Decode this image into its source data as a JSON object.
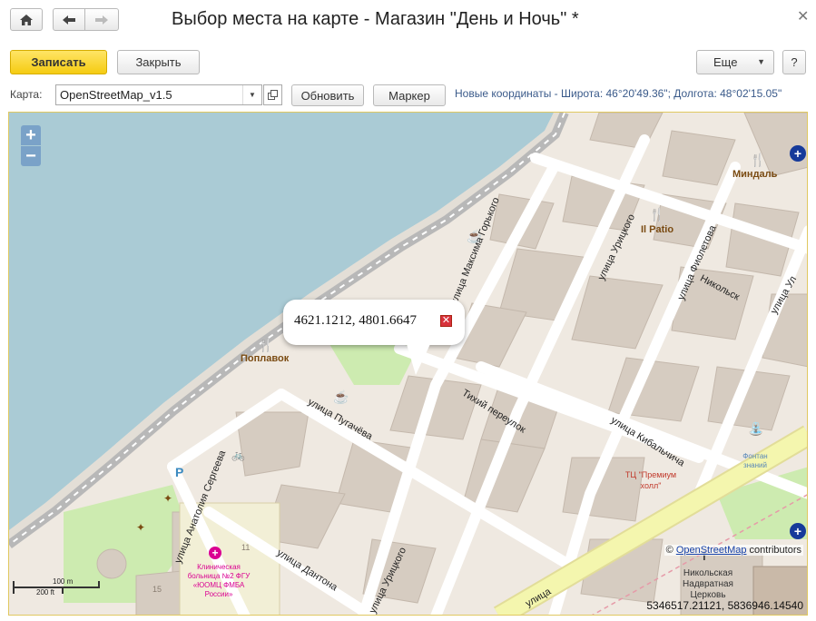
{
  "window": {
    "title": "Выбор места на карте - Магазин \"День и Ночь\" *",
    "home_icon": "home-icon",
    "back_icon": "arrow-left-icon",
    "forward_icon": "arrow-right-icon",
    "close_icon": "close-icon"
  },
  "toolbar": {
    "save_label": "Записать",
    "close_label": "Закрыть",
    "more_label": "Еще",
    "help_label": "?"
  },
  "mapbar": {
    "map_label": "Карта:",
    "map_value": "OpenStreetMap_v1.5",
    "refresh_label": "Обновить",
    "marker_label": "Маркер",
    "new_coords": "Новые координаты - Широта: 46°20'49.36\"; Долгота: 48°02'15.05\""
  },
  "map": {
    "zoom_in": "+",
    "zoom_out": "−",
    "popup_text": "4621.1212, 4801.6647",
    "popup_close": "✕",
    "pois": {
      "mindal": "Миндаль",
      "patio": "Il Patio",
      "poplavok": "Поплавок",
      "tc": "ТЦ \"Премиум холл\"",
      "fountain": "Фонтан знаний",
      "hospital": "Клиническая больница №2 ФГУ «ЮОМЦ ФМБА России»",
      "church": "Никольская Надвратная Церковь"
    },
    "streets": {
      "gorky": "улица Максима Горького",
      "uritsky1": "улица Урицкого",
      "uritsky2": "улица Урицкого",
      "fioletova": "улица Фиолетова",
      "nikolsk": "Никольск",
      "uly": "улица Ул",
      "tikhy": "Тихий переулок",
      "kibalchicha": "улица Кибальчича",
      "pugacheva": "улица Пугачёва",
      "sergeeva": "улица Анатолия Сергеева",
      "dantona": "улица Дантона",
      "ulitsa": "улица"
    },
    "numbers": {
      "n11": "11",
      "n15": "15"
    },
    "scale": {
      "meters": "100 m",
      "feet": "200 ft"
    },
    "attribution_prefix": "© ",
    "attribution_link": "OpenStreetMap",
    "attribution_suffix": " contributors",
    "cursor_coords": "5346517.21121, 5836946.14540",
    "colors": {
      "water": "#aacbd5",
      "building": "#d6ccc1",
      "land": "#efe9e1",
      "green": "#cdebb0",
      "primary_road": "#f4f6ae"
    }
  }
}
